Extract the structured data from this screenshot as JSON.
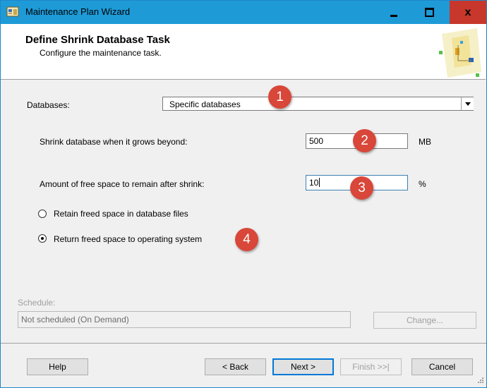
{
  "window": {
    "title": "Maintenance Plan Wizard",
    "min_label": "",
    "max_label": "",
    "close_label": "x"
  },
  "header": {
    "title": "Define Shrink Database Task",
    "subtitle": "Configure the maintenance task.",
    "graphic_icon": "wizard-graphic-icon"
  },
  "form": {
    "databases_label": "Databases:",
    "databases_value": "Specific databases",
    "shrink_label": "Shrink database when it grows beyond:",
    "shrink_value": "500",
    "shrink_unit": "MB",
    "free_space_label": "Amount of free space to remain after shrink:",
    "free_space_value": "10",
    "free_space_unit": "%",
    "radio_retain_label": "Retain freed space in database files",
    "radio_retain_selected": false,
    "radio_return_label": "Return freed space to operating system",
    "radio_return_selected": true
  },
  "annotations": {
    "b1": "1",
    "b2": "2",
    "b3": "3",
    "b4": "4",
    "color": "#d84739"
  },
  "schedule": {
    "label": "Schedule:",
    "value": "Not scheduled (On Demand)",
    "change_label": "Change..."
  },
  "buttons": {
    "help": "Help",
    "back": "< Back",
    "next": "Next >",
    "finish": "Finish >>|",
    "cancel": "Cancel"
  },
  "colors": {
    "titlebar": "#1e9ad7",
    "close": "#c7372c",
    "accent": "#0078d7"
  }
}
